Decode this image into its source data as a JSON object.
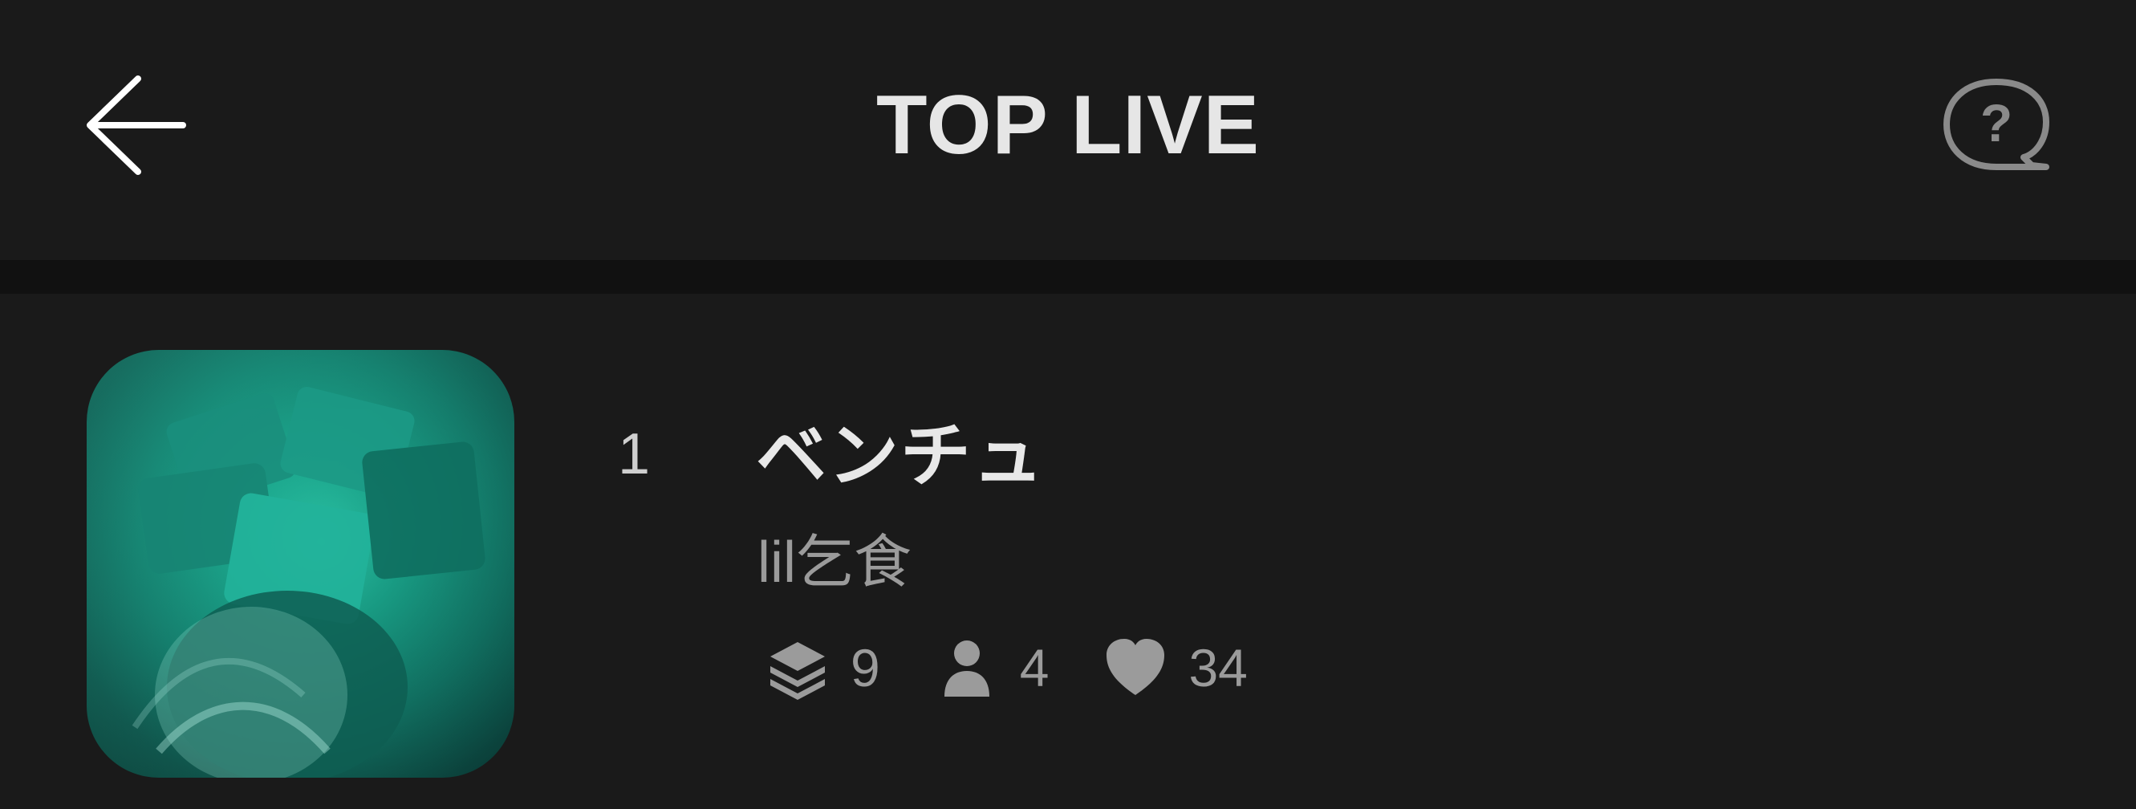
{
  "header": {
    "title": "TOP LIVE",
    "back_icon": "arrow-left-icon",
    "help_icon": "question-bubble-icon"
  },
  "list": {
    "items": [
      {
        "rank": "1",
        "title": "ベンチュ",
        "artist": "lil乞食",
        "stats": {
          "layers": "9",
          "users": "4",
          "likes": "34"
        },
        "thumbnail_description": "artwork-image"
      }
    ]
  },
  "colors": {
    "background": "#1a1a1a",
    "separator": "#111111",
    "title_text": "#e6e6e6",
    "secondary_text": "#9b9b9b",
    "thumbnail_accent": "#2fd1b0"
  }
}
